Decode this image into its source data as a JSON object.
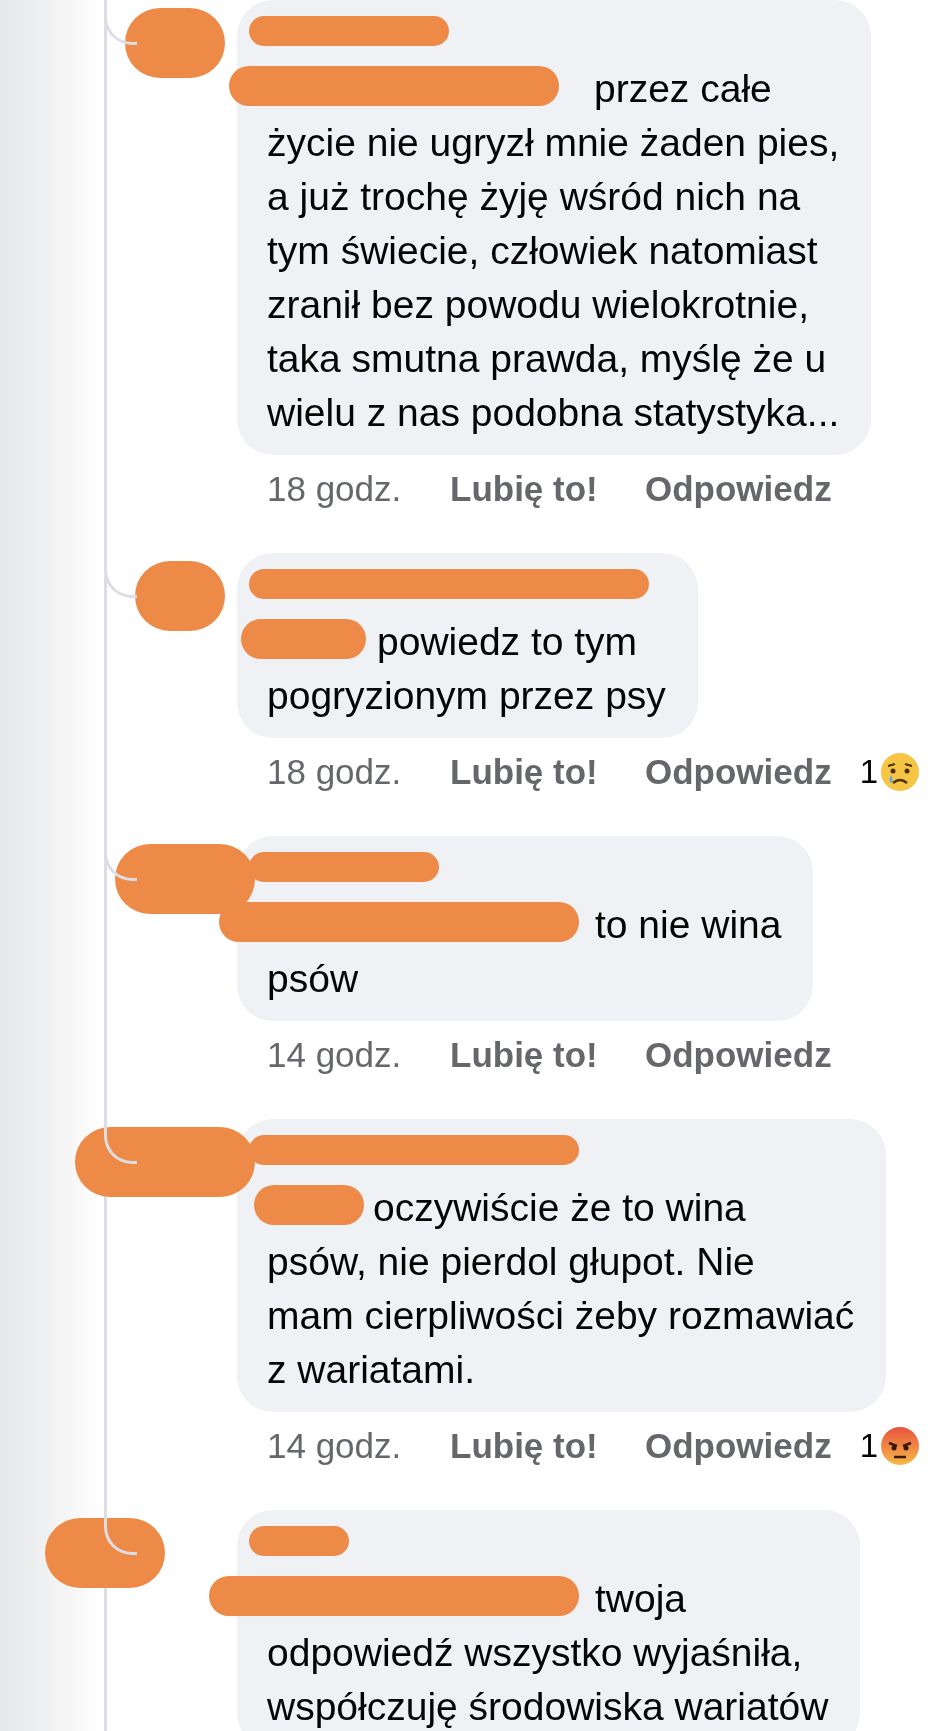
{
  "comments": [
    {
      "text_lines": [
        "przez całe",
        "życie nie ugryzł mnie żaden pies,",
        "a już trochę żyję wśród nich na",
        "tym świecie, człowiek natomiast",
        "zranił bez powodu wielokrotnie,",
        "taka smutna prawda, myślę że u",
        "wielu z nas podobna statystyka..."
      ],
      "time": "18 godz.",
      "like": "Lubię to!",
      "reply": "Odpowiedz"
    },
    {
      "text_lines": [
        "powiedz to tym",
        "pogryzionym przez psy"
      ],
      "time": "18 godz.",
      "like": "Lubię to!",
      "reply": "Odpowiedz",
      "reaction": {
        "count": "1",
        "kind": "sad"
      }
    },
    {
      "text_lines": [
        "to nie wina",
        "psów"
      ],
      "time": "14 godz.",
      "like": "Lubię to!",
      "reply": "Odpowiedz"
    },
    {
      "text_lines": [
        "oczywiście że to wina",
        "psów, nie pierdol głupot. Nie",
        "mam cierpliwości żeby rozmawiać",
        "z wariatami."
      ],
      "time": "14 godz.",
      "like": "Lubię to!",
      "reply": "Odpowiedz",
      "reaction": {
        "count": "1",
        "kind": "angry"
      }
    },
    {
      "text_lines": [
        "twoja",
        "odpowiedź wszystko wyjaśniła,",
        "współczuję środowiska wariatów"
      ]
    }
  ]
}
